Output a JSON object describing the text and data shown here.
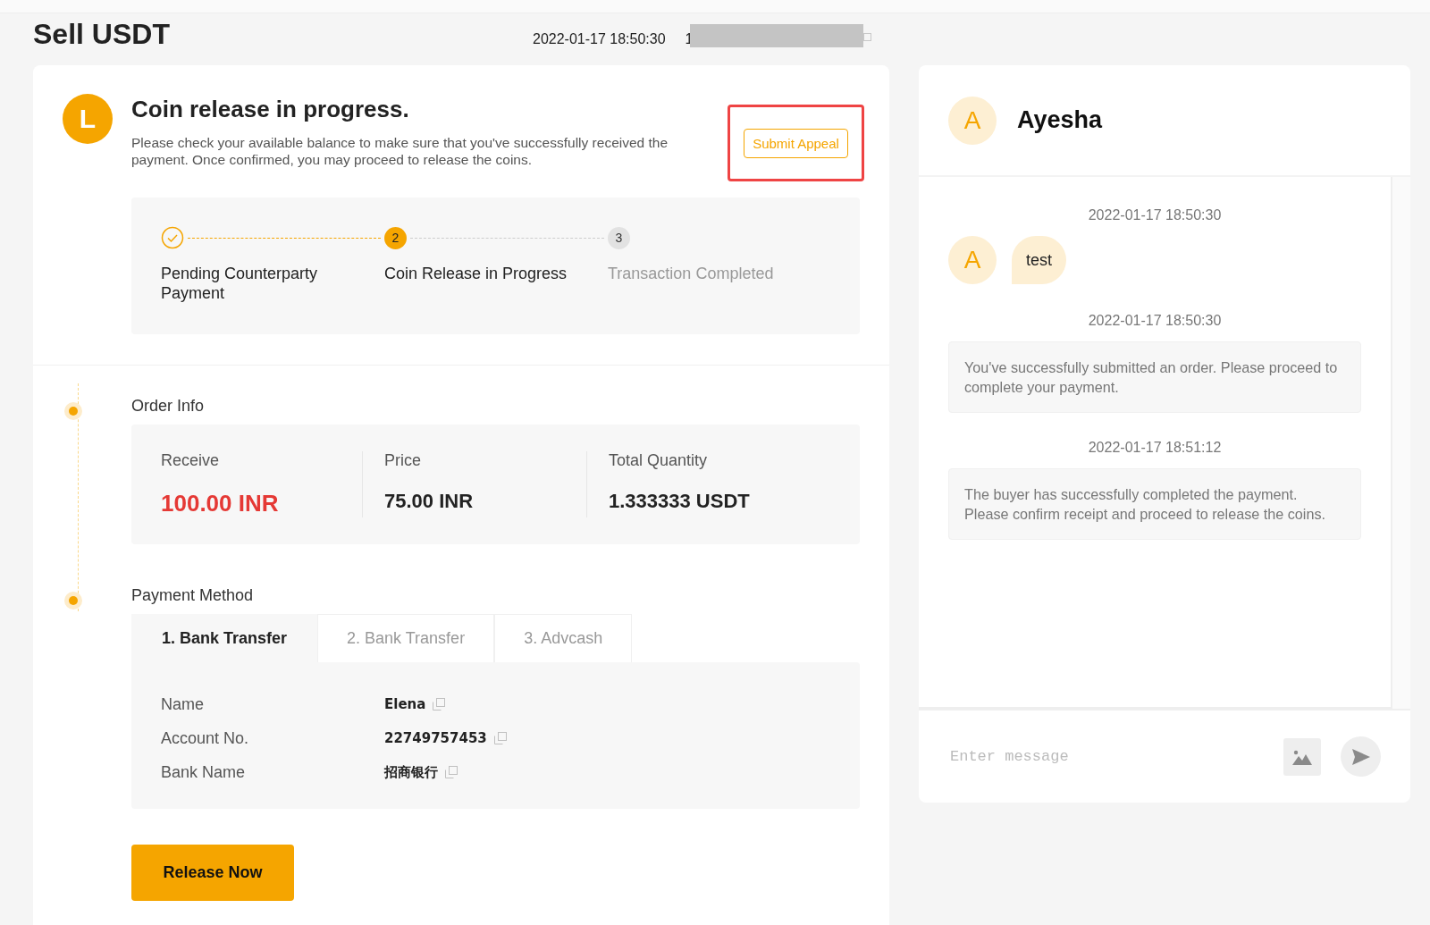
{
  "page_title": "Sell USDT",
  "order_time": "2022-01-17 18:50:30",
  "order_number": "1",
  "status": {
    "icon": "L",
    "title": "Coin release in progress.",
    "description": "Please check your available balance to make sure that you've successfully received the payment. Once confirmed, you may proceed to release the coins.",
    "appeal_button": "Submit Appeal"
  },
  "steps": [
    {
      "label": "Pending Counterparty Payment",
      "completed": true,
      "current": false
    },
    {
      "number": "2",
      "label": "Coin Release in Progress",
      "completed": false,
      "current": true
    },
    {
      "number": "3",
      "label": "Transaction Completed",
      "completed": false,
      "current": false
    }
  ],
  "order_info": {
    "title": "Order Info",
    "items": [
      {
        "label": "Receive",
        "value": "100.00 INR",
        "highlight": true
      },
      {
        "label": "Price",
        "value": "75.00 INR",
        "highlight": false
      },
      {
        "label": "Total Quantity",
        "value": "1.333333 USDT",
        "highlight": false
      }
    ]
  },
  "payment": {
    "title": "Payment Method",
    "tabs": [
      {
        "label": "1. Bank Transfer",
        "selected": true
      },
      {
        "label": "2. Bank Transfer",
        "selected": false
      },
      {
        "label": "3. Advcash",
        "selected": false
      }
    ],
    "fields": [
      {
        "label": "Name",
        "value": "Elena"
      },
      {
        "label": "Account No.",
        "value": "22749757453"
      },
      {
        "label": "Bank Name",
        "value": "招商银行"
      }
    ]
  },
  "release_button": "Release Now",
  "chat": {
    "avatar": "A",
    "name": "Ayesha",
    "messages": [
      {
        "kind": "user",
        "time": "2022-01-17 18:50:30",
        "avatar": "A",
        "text": "test"
      },
      {
        "kind": "system",
        "time": "2022-01-17 18:50:30",
        "text": "You've successfully submitted an order. Please proceed to complete your payment."
      },
      {
        "kind": "system",
        "time": "2022-01-17 18:51:12",
        "text": "The buyer has successfully completed the payment. Please confirm receipt and proceed to release the coins."
      }
    ],
    "input": {
      "placeholder": "Enter message"
    }
  }
}
